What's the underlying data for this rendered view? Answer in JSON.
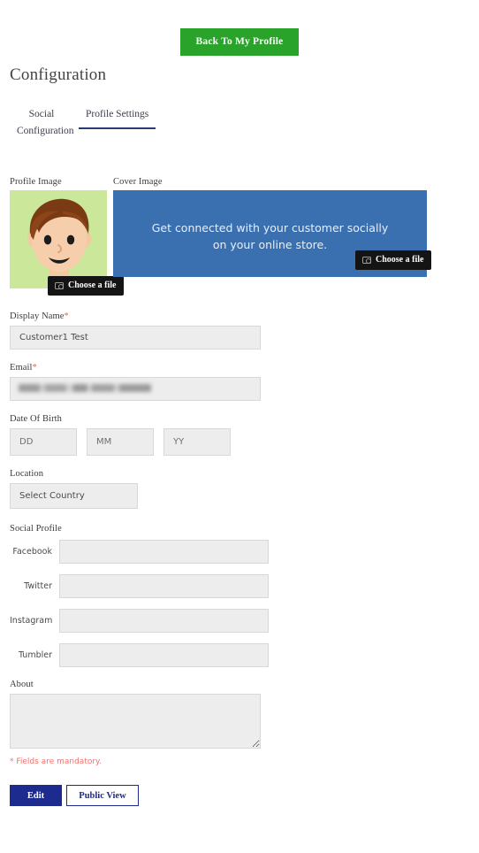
{
  "header": {
    "back_button": "Back To My Profile",
    "page_title": "Configuration"
  },
  "tabs": [
    {
      "label": "Social Configuration",
      "active": false,
      "name": "tab-social-configuration"
    },
    {
      "label": "Profile Settings",
      "active": true,
      "name": "tab-profile-settings"
    }
  ],
  "images": {
    "profile_label": "Profile Image",
    "cover_label": "Cover Image",
    "choose_file_label": "Choose a file",
    "cover_text_line1": "Get connected with your customer socially",
    "cover_text_line2": "on your online store.",
    "profile_bg_color": "#cbe79a",
    "cover_bg_color": "#3a6fb0",
    "choose_btn_bg": "#141414",
    "profile_avatar_alt": "cartoon boy avatar"
  },
  "form": {
    "display_name": {
      "label": "Display Name",
      "required_marker": "*",
      "value": "Customer1 Test",
      "placeholder": ""
    },
    "email": {
      "label": "Email",
      "required_marker": "*",
      "value": "",
      "placeholder": "",
      "redacted": true
    },
    "dob": {
      "label": "Date Of Birth",
      "day_placeholder": "DD",
      "month_placeholder": "MM",
      "year_placeholder": "YY",
      "day_value": "",
      "month_value": "",
      "year_value": ""
    },
    "location": {
      "label": "Location",
      "selected": "Select Country"
    },
    "social": {
      "label": "Social Profile",
      "fields": [
        {
          "label": "Facebook",
          "value": "",
          "placeholder": ""
        },
        {
          "label": "Twitter",
          "value": "",
          "placeholder": ""
        },
        {
          "label": "Instagram",
          "value": "",
          "placeholder": ""
        },
        {
          "label": "Tumbler",
          "value": "",
          "placeholder": ""
        }
      ]
    },
    "about": {
      "label": "About",
      "value": "",
      "placeholder": ""
    },
    "mandatory_note": "* Fields are mandatory."
  },
  "footer": {
    "edit_label": "Edit",
    "public_view_label": "Public View",
    "primary_color": "#1d2b8f",
    "accent_green": "#2aa32a"
  }
}
